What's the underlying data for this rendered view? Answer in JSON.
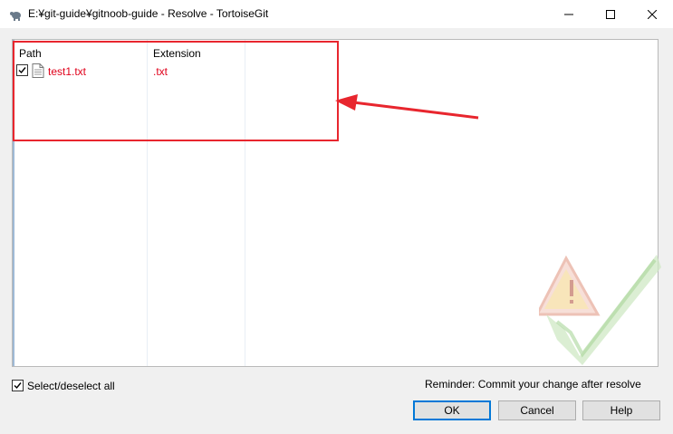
{
  "window": {
    "title": "E:¥git-guide¥gitnoob-guide - Resolve - TortoiseGit",
    "app_icon": "tortoisegit-icon",
    "controls": [
      "minimize-icon",
      "maximize-icon",
      "close-icon"
    ]
  },
  "list": {
    "columns": [
      "Path",
      "Extension"
    ],
    "rows": [
      {
        "checked": true,
        "icon": "text-file-icon",
        "path": "test1.txt",
        "extension": ".txt"
      }
    ]
  },
  "annotation": {
    "color": "#e8262e"
  },
  "footer": {
    "select_all_label": "Select/deselect all",
    "select_all_checked": true,
    "reminder": "Reminder: Commit your change after resolve"
  },
  "buttons": {
    "ok": "OK",
    "cancel": "Cancel",
    "help": "Help"
  },
  "colors": {
    "conflict_text": "#e0001a",
    "default_button_border": "#0078d7"
  }
}
